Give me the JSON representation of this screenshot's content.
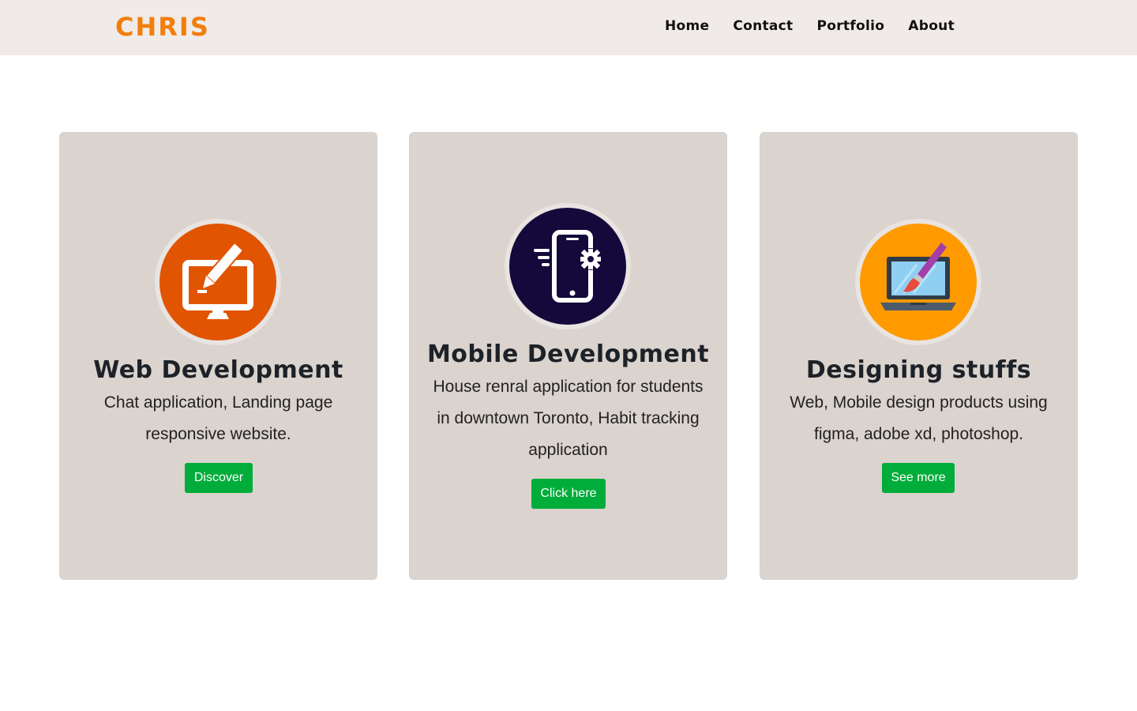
{
  "navbar": {
    "brand": "CHRIS",
    "links": [
      {
        "label": "Home"
      },
      {
        "label": "Contact"
      },
      {
        "label": "Portfolio"
      },
      {
        "label": "About"
      }
    ]
  },
  "cards": [
    {
      "icon": "monitor-pen-icon",
      "title": "Web Development",
      "text": "Chat application, Landing page responsive website.",
      "button": "Discover",
      "icon_bg": "#e05402"
    },
    {
      "icon": "smartphone-gear-icon",
      "title": "Mobile Development",
      "text": "House renral application for students in downtown Toronto, Habit tracking application",
      "button": "Click here",
      "icon_bg": "#14093a"
    },
    {
      "icon": "laptop-paintbrush-icon",
      "title": "Designing stuffs",
      "text": "Web, Mobile design products using figma, adobe xd, photoshop.",
      "button": "See more",
      "icon_bg": "#ff9a00"
    }
  ],
  "colors": {
    "brand": "#f27e0c",
    "navbar_bg": "#f0ebe8",
    "card_bg": "#dad3ce",
    "button_bg": "#00ac3a"
  }
}
